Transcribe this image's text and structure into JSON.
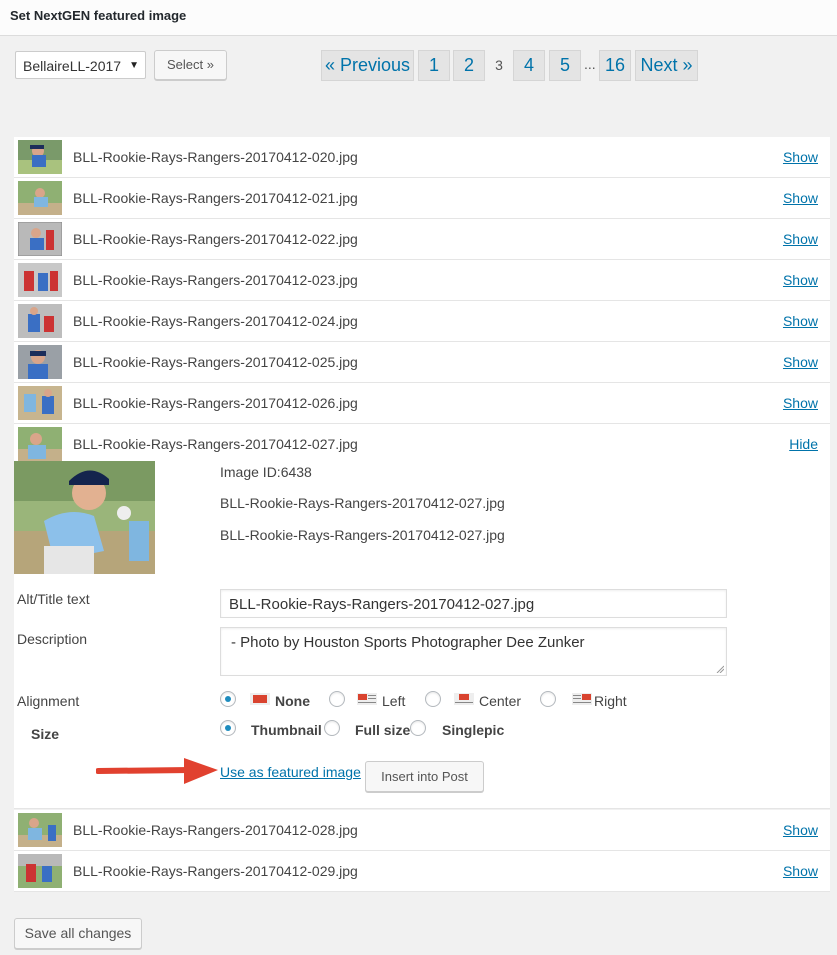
{
  "title": "Set NextGEN featured image",
  "gallery_select": {
    "value": "BellaireLL-2017"
  },
  "select_button": "Select »",
  "pagination": {
    "previous": "« Previous",
    "pages": [
      "1",
      "2",
      "3",
      "4",
      "5",
      "16"
    ],
    "current": "3",
    "ellipsis": "...",
    "next": "Next »"
  },
  "images_top": [
    {
      "file": "BLL-Rookie-Rays-Rangers-20170412-020.jpg",
      "action": "Show"
    },
    {
      "file": "BLL-Rookie-Rays-Rangers-20170412-021.jpg",
      "action": "Show"
    },
    {
      "file": "BLL-Rookie-Rays-Rangers-20170412-022.jpg",
      "action": "Show"
    },
    {
      "file": "BLL-Rookie-Rays-Rangers-20170412-023.jpg",
      "action": "Show"
    },
    {
      "file": "BLL-Rookie-Rays-Rangers-20170412-024.jpg",
      "action": "Show"
    },
    {
      "file": "BLL-Rookie-Rays-Rangers-20170412-025.jpg",
      "action": "Show"
    },
    {
      "file": "BLL-Rookie-Rays-Rangers-20170412-026.jpg",
      "action": "Show"
    },
    {
      "file": "BLL-Rookie-Rays-Rangers-20170412-027.jpg",
      "action": "Hide"
    }
  ],
  "detail": {
    "image_id": "Image ID:6438",
    "filename_1": "BLL-Rookie-Rays-Rangers-20170412-027.jpg",
    "filename_2": "BLL-Rookie-Rays-Rangers-20170412-027.jpg",
    "alt_label": "Alt/Title text",
    "alt_value": "BLL-Rookie-Rays-Rangers-20170412-027.jpg",
    "description_label": "Description",
    "description_value": "- Photo by Houston Sports Photographer Dee Zunker",
    "alignment_label": "Alignment",
    "alignment_options": [
      "None",
      "Left",
      "Center",
      "Right"
    ],
    "alignment_selected": "None",
    "size_label": "Size",
    "size_options": [
      "Thumbnail",
      "Full size",
      "Singlepic"
    ],
    "size_selected": "Thumbnail",
    "use_featured": "Use as featured image",
    "insert_post": "Insert into Post"
  },
  "images_bottom": [
    {
      "file": "BLL-Rookie-Rays-Rangers-20170412-028.jpg",
      "action": "Show"
    },
    {
      "file": "BLL-Rookie-Rays-Rangers-20170412-029.jpg",
      "action": "Show"
    }
  ],
  "save_button": "Save all changes",
  "colors": {
    "link": "#0073aa",
    "arrow": "#e1412f",
    "radio_checked": "#1e8cbe"
  },
  "icons": [
    "dropdown-arrow-icon",
    "align-none-icon",
    "align-left-icon",
    "align-center-icon",
    "align-right-icon",
    "red-arrow-annotation-icon"
  ]
}
